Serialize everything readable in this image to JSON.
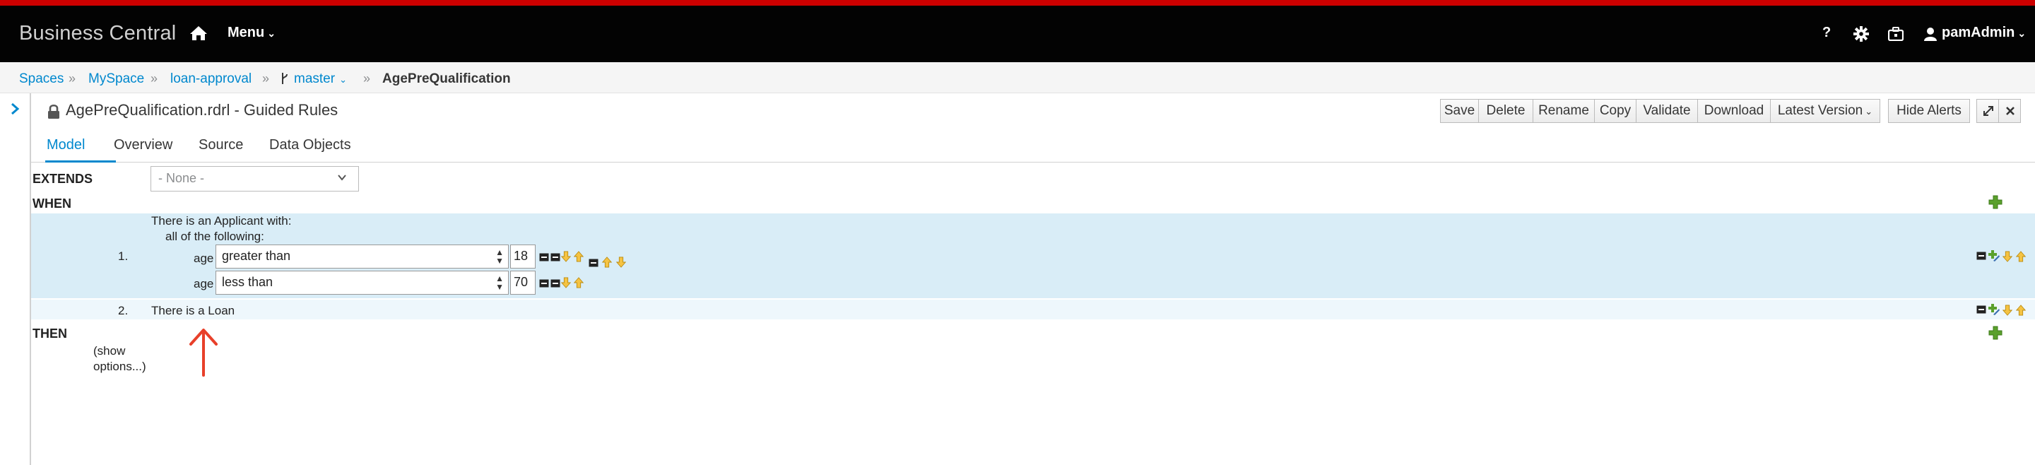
{
  "navbar": {
    "brand": "Business Central",
    "menu_label": "Menu",
    "help_label": "?",
    "user_label": "pamAdmin"
  },
  "breadcrumb": {
    "items": [
      "Spaces",
      "MySpace",
      "loan-approval",
      "master",
      "AgePreQualification"
    ]
  },
  "editor": {
    "title": "AgePreQualification.rdrl - Guided Rules",
    "toolbar": [
      "Save",
      "Delete",
      "Rename",
      "Copy",
      "Validate",
      "Download",
      "Latest Version",
      "Hide Alerts"
    ],
    "tabs": [
      "Model",
      "Overview",
      "Source",
      "Data Objects"
    ],
    "active_tab": "Model"
  },
  "rule": {
    "extends_label": "EXTENDS",
    "extends_value": "- None -",
    "when_label": "WHEN",
    "then_label": "THEN",
    "show_options": [
      "(show",
      "options...)"
    ],
    "conditions": [
      {
        "number": "1.",
        "header": "There is an Applicant with:",
        "subheader": "all of the following:",
        "constraints": [
          {
            "field": "age",
            "operator": "greater than",
            "value": "18"
          },
          {
            "field": "age",
            "operator": "less than",
            "value": "70"
          }
        ]
      },
      {
        "number": "2.",
        "header": "There is a Loan"
      }
    ]
  },
  "colors": {
    "accent": "#0088ce",
    "navbar": "#030303",
    "top_stripe": "#cc0000",
    "when_band": "#d9edf7",
    "annotation_arrow": "#e8402a"
  }
}
